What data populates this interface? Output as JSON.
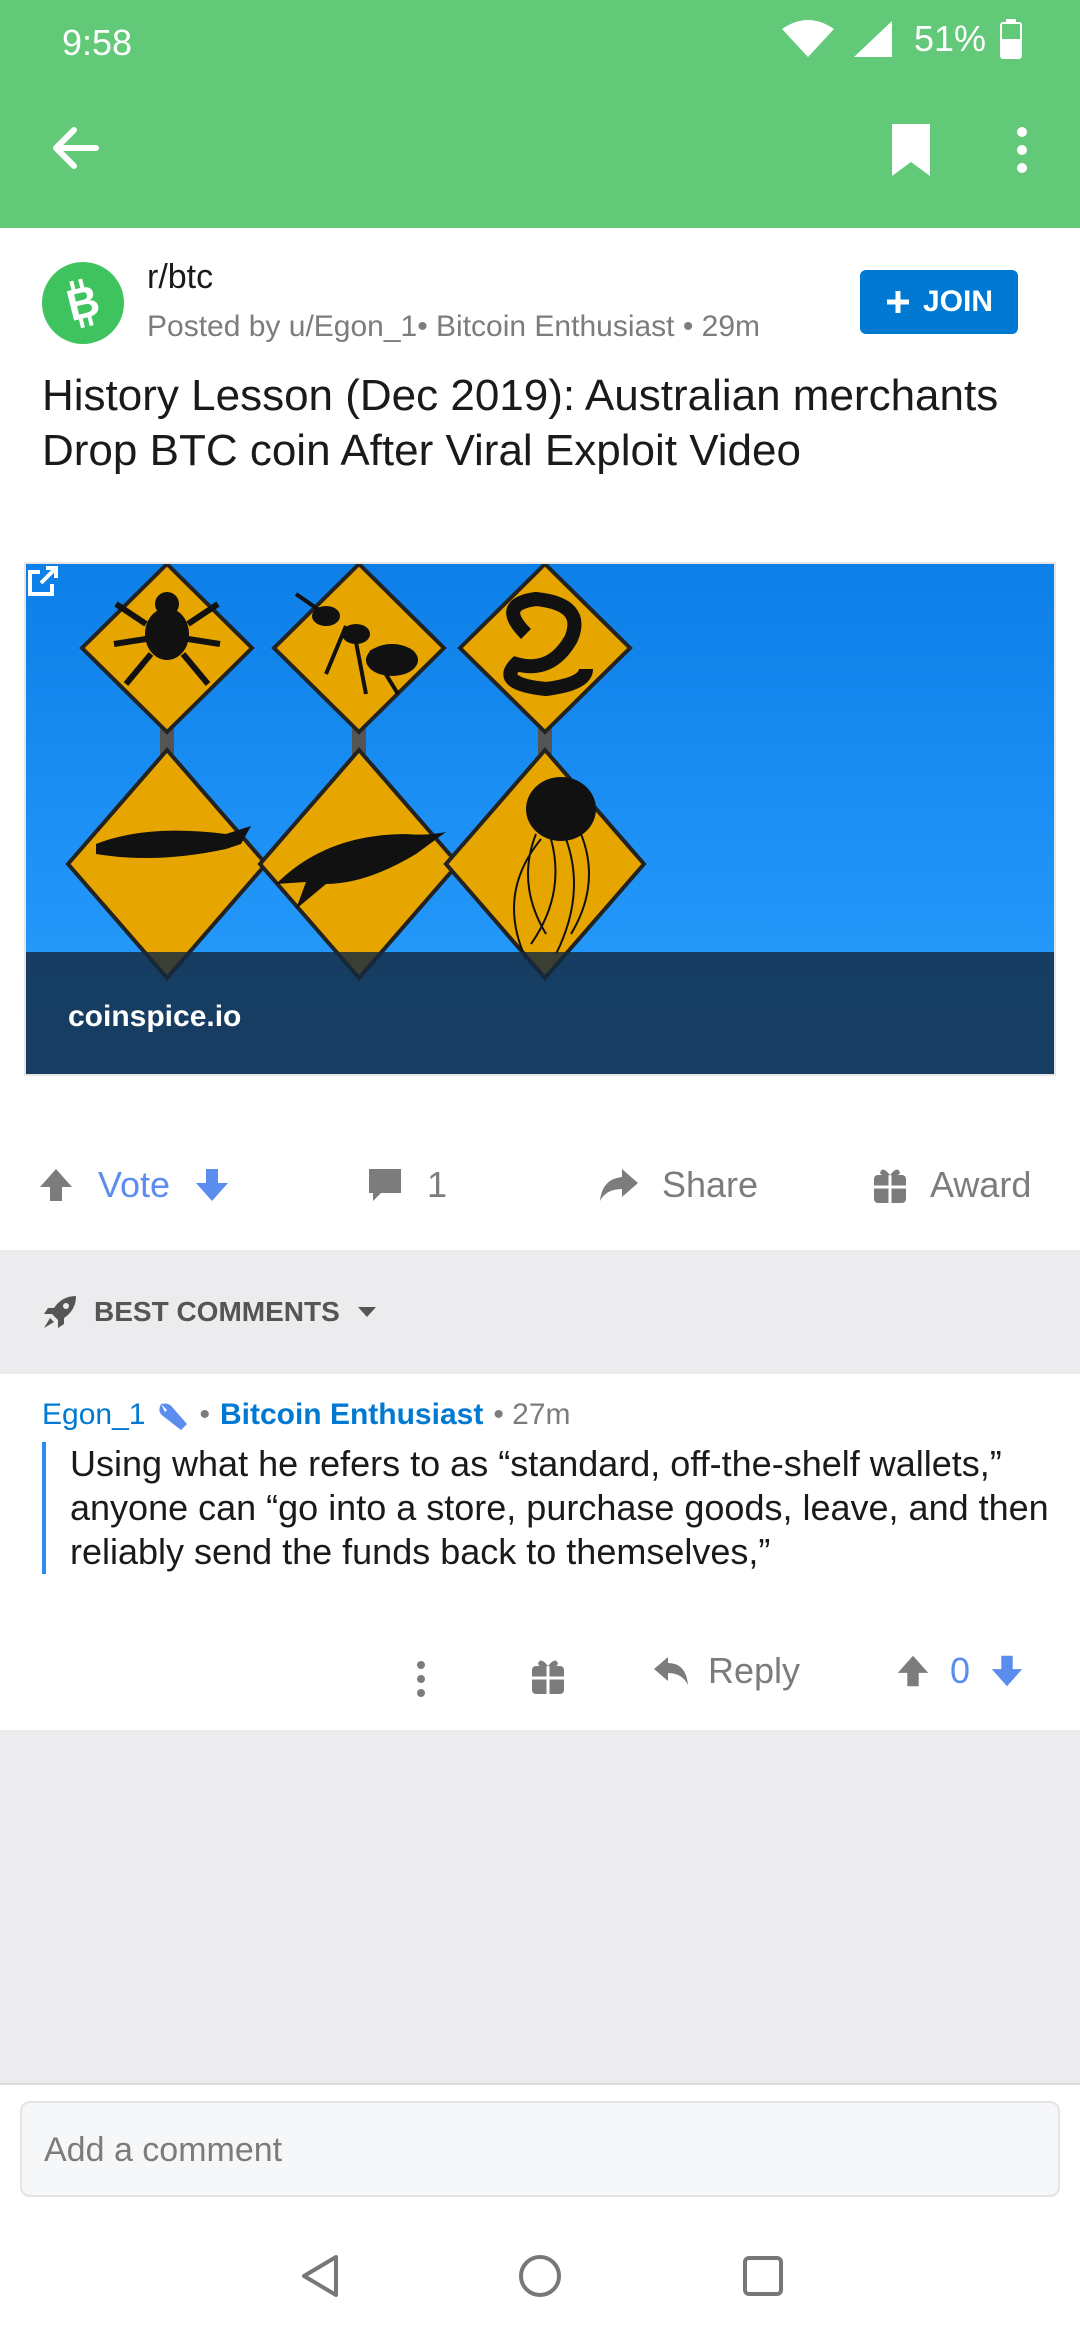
{
  "status_bar": {
    "time": "9:58",
    "battery": "51%"
  },
  "app_bar": {
    "back_icon": "arrow-left-icon",
    "bookmark_icon": "bookmark-icon",
    "more_icon": "more-vertical-icon"
  },
  "post": {
    "subreddit": "r/btc",
    "meta": "Posted by u/Egon_1• Bitcoin Enthusiast • 29m",
    "join_label": "JOIN",
    "title": "History Lesson (Dec 2019): Australian merchants Drop BTC coin After Viral Exploit Video",
    "link_domain": "coinspice.io"
  },
  "actions": {
    "vote_label": "Vote",
    "comment_count": "1",
    "share_label": "Share",
    "award_label": "Award"
  },
  "comments_header": {
    "sort_label": "BEST COMMENTS"
  },
  "comment": {
    "author": "Egon_1",
    "separator": "•",
    "flair": "Bitcoin Enthusiast",
    "age": "• 27m",
    "body": "Using what he refers to as “standard, off-the-shelf wallets,” anyone can “go into a store, purchase goods, leave, and then reliably send the funds back to themselves,”",
    "reply_label": "Reply",
    "score": "0"
  },
  "composer": {
    "placeholder": "Add a comment"
  },
  "colors": {
    "app_bar": "#61c977",
    "join": "#0079d3",
    "vote": "#5b8def",
    "flair": "#0079d3"
  }
}
